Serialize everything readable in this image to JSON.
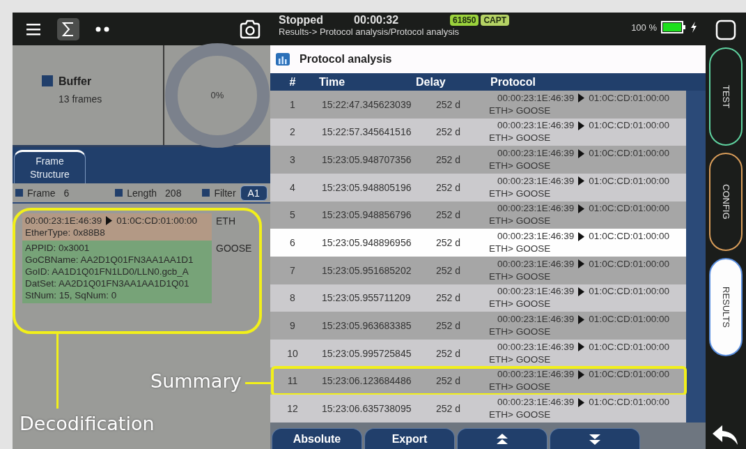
{
  "left_header": {
    "tools": [
      {
        "kind": "menu",
        "selected": false
      },
      {
        "kind": "sigma",
        "selected": true
      },
      {
        "kind": "dots",
        "selected": false
      }
    ]
  },
  "buffer": {
    "label": "Buffer",
    "frames": "13 frames",
    "usage": "0%"
  },
  "tabs": [
    {
      "label": "Frame Structure",
      "selected": true
    }
  ],
  "frame_info": {
    "frame_label": "Frame",
    "frame": "6",
    "length_label": "Length",
    "length": "208",
    "filter_label": "Filter",
    "filter": "A1"
  },
  "decode": {
    "highlighted": true,
    "layers": [
      {
        "name": "ETH",
        "color": "#b39985",
        "lines": [
          {
            "kind": "addr",
            "src": "00:00:23:1E:46:39",
            "dst": "01:0C:CD:01:00:00"
          },
          {
            "kind": "text",
            "text": "EtherType: 0x88B8"
          }
        ]
      },
      {
        "name": "GOOSE",
        "color": "#77a378",
        "lines": [
          {
            "kind": "text",
            "text": "APPID: 0x3001"
          },
          {
            "kind": "text",
            "text": "GoCBName: AA2D1Q01FN3AA1AA1D1"
          },
          {
            "kind": "text",
            "text": "GoID: AA1D1Q01FN1LD0/LLN0.gcb_A"
          },
          {
            "kind": "text",
            "text": "DatSet: AA2D1Q01FN3AA1AA1D1Q01"
          },
          {
            "kind": "text",
            "text": "StNum: 15, SqNum: 0"
          }
        ]
      }
    ]
  },
  "status": {
    "state": "Stopped",
    "elapsed": "00:00:32",
    "badges": [
      {
        "text": "61850",
        "color": "#9bd23c"
      },
      {
        "text": "CAPT",
        "color": "#b5d264"
      }
    ],
    "breadcrumb": "Results-> Protocol analysis/Protocol analysis",
    "battery": "100 %"
  },
  "panel_title": "Protocol analysis",
  "table": {
    "columns": [
      "#",
      "Time",
      "Delay",
      "Protocol"
    ],
    "rows": [
      {
        "n": "1",
        "time": "15:22:47.345623039",
        "delay": "252 d",
        "src": "00:00:23:1E:46:39",
        "dst": "01:0C:CD:01:00:00",
        "stack": "ETH> GOOSE",
        "selected": false,
        "highlighted": false
      },
      {
        "n": "2",
        "time": "15:22:57.345641516",
        "delay": "252 d",
        "src": "00:00:23:1E:46:39",
        "dst": "01:0C:CD:01:00:00",
        "stack": "ETH> GOOSE",
        "selected": false,
        "highlighted": false
      },
      {
        "n": "3",
        "time": "15:23:05.948707356",
        "delay": "252 d",
        "src": "00:00:23:1E:46:39",
        "dst": "01:0C:CD:01:00:00",
        "stack": "ETH> GOOSE",
        "selected": false,
        "highlighted": false
      },
      {
        "n": "4",
        "time": "15:23:05.948805196",
        "delay": "252 d",
        "src": "00:00:23:1E:46:39",
        "dst": "01:0C:CD:01:00:00",
        "stack": "ETH> GOOSE",
        "selected": false,
        "highlighted": false
      },
      {
        "n": "5",
        "time": "15:23:05.948856796",
        "delay": "252 d",
        "src": "00:00:23:1E:46:39",
        "dst": "01:0C:CD:01:00:00",
        "stack": "ETH> GOOSE",
        "selected": false,
        "highlighted": false
      },
      {
        "n": "6",
        "time": "15:23:05.948896956",
        "delay": "252 d",
        "src": "00:00:23:1E:46:39",
        "dst": "01:0C:CD:01:00:00",
        "stack": "ETH> GOOSE",
        "selected": true,
        "highlighted": false
      },
      {
        "n": "7",
        "time": "15:23:05.951685202",
        "delay": "252 d",
        "src": "00:00:23:1E:46:39",
        "dst": "01:0C:CD:01:00:00",
        "stack": "ETH> GOOSE",
        "selected": false,
        "highlighted": false
      },
      {
        "n": "8",
        "time": "15:23:05.955711209",
        "delay": "252 d",
        "src": "00:00:23:1E:46:39",
        "dst": "01:0C:CD:01:00:00",
        "stack": "ETH> GOOSE",
        "selected": false,
        "highlighted": false
      },
      {
        "n": "9",
        "time": "15:23:05.963683385",
        "delay": "252 d",
        "src": "00:00:23:1E:46:39",
        "dst": "01:0C:CD:01:00:00",
        "stack": "ETH> GOOSE",
        "selected": false,
        "highlighted": false
      },
      {
        "n": "10",
        "time": "15:23:05.995725845",
        "delay": "252 d",
        "src": "00:00:23:1E:46:39",
        "dst": "01:0C:CD:01:00:00",
        "stack": "ETH> GOOSE",
        "selected": false,
        "highlighted": false
      },
      {
        "n": "11",
        "time": "15:23:06.123684486",
        "delay": "252 d",
        "src": "00:00:23:1E:46:39",
        "dst": "01:0C:CD:01:00:00",
        "stack": "ETH> GOOSE",
        "selected": false,
        "highlighted": true
      },
      {
        "n": "12",
        "time": "15:23:06.635738095",
        "delay": "252 d",
        "src": "00:00:23:1E:46:39",
        "dst": "01:0C:CD:01:00:00",
        "stack": "ETH> GOOSE",
        "selected": false,
        "highlighted": false
      }
    ]
  },
  "bottom_buttons": [
    {
      "kind": "text",
      "label": "Absolute"
    },
    {
      "kind": "text",
      "label": "Export"
    },
    {
      "kind": "up"
    },
    {
      "kind": "down"
    }
  ],
  "side_tabs": [
    {
      "label": "TEST",
      "color": "#5fd3a0",
      "selected": false
    },
    {
      "label": "CONFIG",
      "color": "#d99d5a",
      "selected": false
    },
    {
      "label": "RESULTS",
      "color": "#5a8fe0",
      "selected": true
    }
  ],
  "annotations": [
    {
      "kind": "summary",
      "text": "Summary"
    },
    {
      "kind": "decode",
      "text": "Decodification"
    }
  ]
}
